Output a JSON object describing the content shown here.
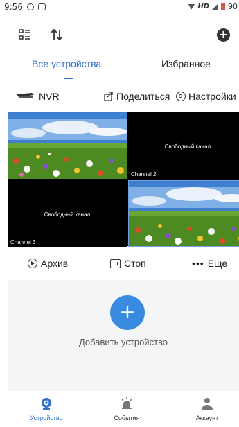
{
  "status_bar": {
    "time": "9:56",
    "network": "HD",
    "battery": "90"
  },
  "tabs": {
    "devices": "Все устройства",
    "favorites": "Избранное"
  },
  "device": {
    "name": "NVR",
    "share": "Поделиться",
    "settings": "Настройки"
  },
  "channels": [
    {
      "label": "",
      "state": "live"
    },
    {
      "label": "Channel 2",
      "state": "free",
      "free_text": "Свободный канал"
    },
    {
      "label": "Channel 3",
      "state": "free",
      "free_text": "Свободный канал"
    },
    {
      "label": "",
      "state": "live"
    }
  ],
  "actions": {
    "archive": "Архив",
    "stop": "Стоп",
    "more": "Еще"
  },
  "empty": {
    "add_device": "Добавить устройство"
  },
  "nav": {
    "devices": "Устройство",
    "events": "События",
    "account": "Аккаунт"
  },
  "colors": {
    "accent": "#2f6fd0",
    "fab": "#3a8ae0"
  }
}
